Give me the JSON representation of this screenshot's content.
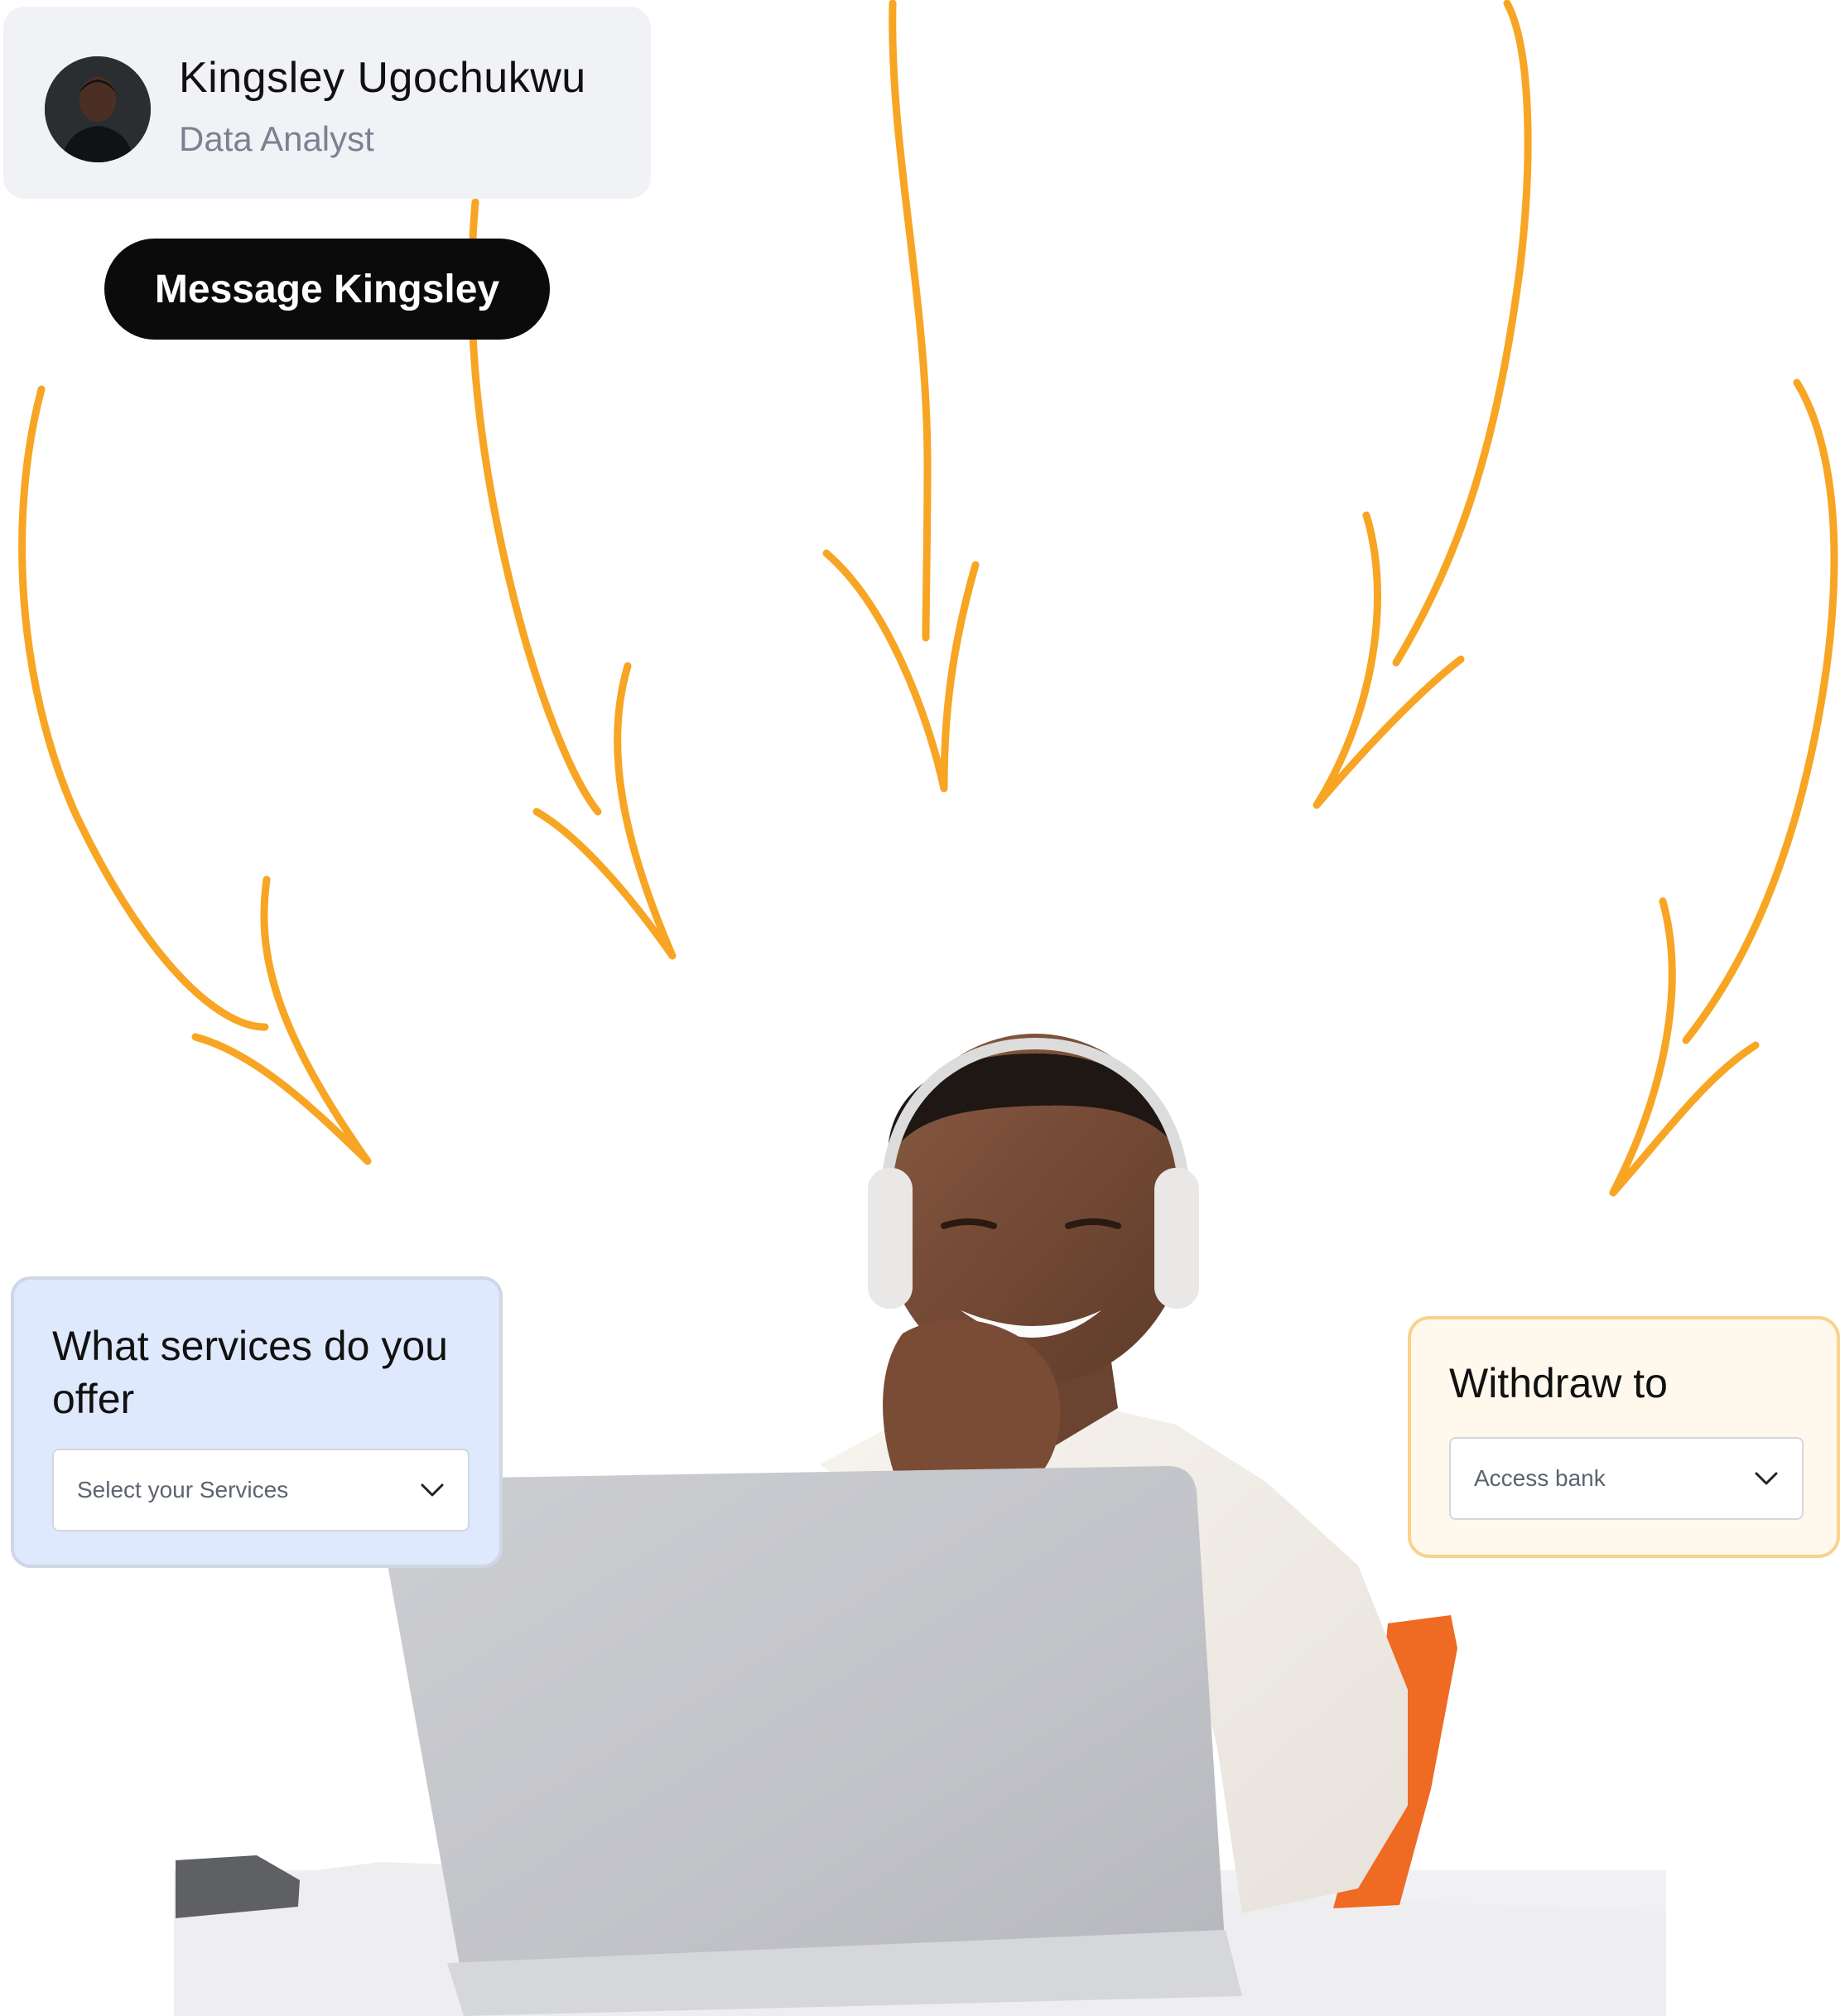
{
  "profile": {
    "name": "Kingsley Ugochukwu",
    "role": "Data Analyst"
  },
  "message_button": {
    "label": "Message Kingsley"
  },
  "services": {
    "title": "What services do you offer",
    "select_value": "Select your Services"
  },
  "withdraw": {
    "title": "Withdraw to",
    "select_value": "Access bank"
  },
  "icons": {
    "avatar": "user-avatar",
    "services_dropdown": "chevron-down-icon",
    "withdraw_dropdown": "chevron-down-icon"
  },
  "colors": {
    "accent_orange": "#f7a523",
    "button_dark": "#0b0b0b",
    "services_card_bg": "#dfe9fd",
    "withdraw_card_bg": "#fff8ec",
    "withdraw_card_border": "#f8d38d"
  }
}
